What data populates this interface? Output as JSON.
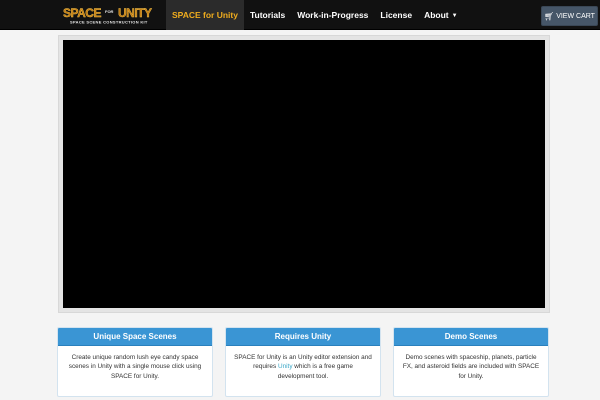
{
  "colors": {
    "navbar": "#111111",
    "active_nav_text": "#f0ad1e",
    "card_header": "#3a95d4",
    "cart_button": "#465668",
    "link": "#3aa7c7"
  },
  "logo": {
    "word_left": "SPACE",
    "word_right": "UNITY",
    "for": "FOR",
    "tagline": "SPACE SCENE CONSTRUCTION KIT"
  },
  "nav": {
    "items": [
      {
        "label": "SPACE for Unity",
        "active": true
      },
      {
        "label": "Tutorials"
      },
      {
        "label": "Work-in-Progress"
      },
      {
        "label": "License"
      },
      {
        "label": "About",
        "dropdown": true
      }
    ],
    "cart_label": "VIEW CART",
    "cart_icon": "shopping-cart-icon"
  },
  "cards": [
    {
      "title": "Unique Space Scenes",
      "body": "Create unique random lush eye candy space scenes in Unity with a single mouse click using SPACE for Unity."
    },
    {
      "title": "Requires Unity",
      "body_before": "SPACE for Unity is an Unity editor extension and requires ",
      "link": "Unity",
      "body_after": " which is a free game development tool."
    },
    {
      "title": "Demo Scenes",
      "body": "Demo scenes with spaceship, planets, particle FX, and asteroid fields are included with SPACE for Unity."
    }
  ]
}
